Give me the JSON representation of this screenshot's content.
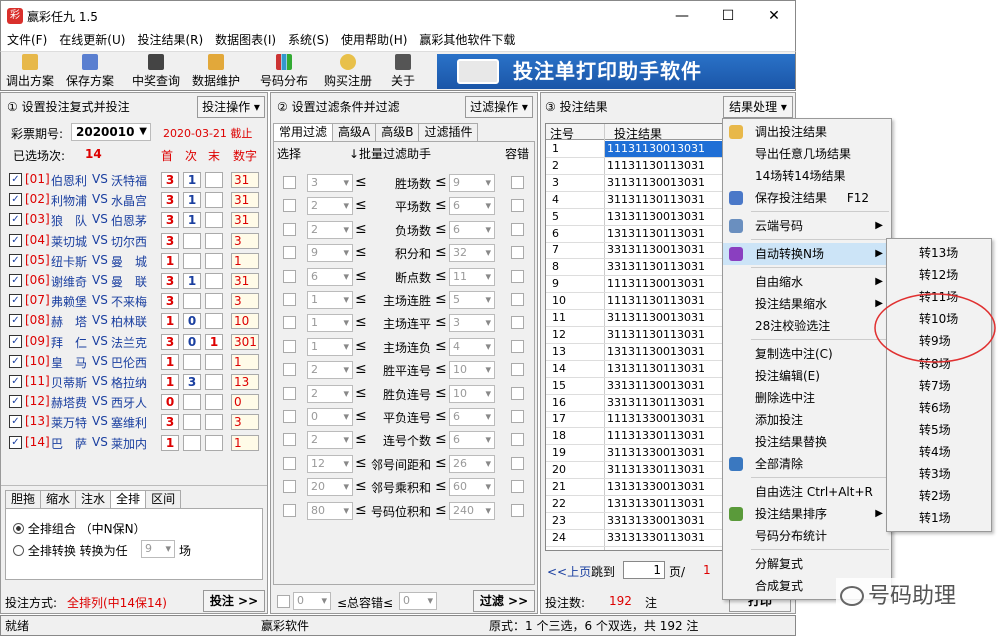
{
  "window": {
    "title": "赢彩任九 1.5",
    "min": "—",
    "max": "☐",
    "close": "✕"
  },
  "menubar": [
    "文件(F)",
    "在线更新(U)",
    "投注结果(R)",
    "数据图表(I)",
    "系统(S)",
    "使用帮助(H)",
    "赢彩其他软件下载"
  ],
  "toolbar": {
    "items": [
      "调出方案",
      "保存方案",
      "中奖查询",
      "数据维护",
      "号码分布",
      "购买注册",
      "关于"
    ],
    "banner": "投注单打印助手软件"
  },
  "left": {
    "header": "① 设置投注复式并投注",
    "op_button": "投注操作 ▾",
    "issue_label": "彩票期号:",
    "issue": "2020010",
    "issue_date": "2020-03-21 截止",
    "selected_label": "已选场次:",
    "selected_count": "14",
    "cols": [
      "首",
      "次",
      "末",
      "数字"
    ],
    "matches": [
      {
        "no": "[01]",
        "home": "伯恩利",
        "away": "沃特福",
        "a": "3",
        "b": "1",
        "c": "",
        "d": "31"
      },
      {
        "no": "[02]",
        "home": "利物浦",
        "away": "水晶宫",
        "a": "3",
        "b": "1",
        "c": "",
        "d": "31"
      },
      {
        "no": "[03]",
        "home": "狼　队",
        "away": "伯恩茅",
        "a": "3",
        "b": "1",
        "c": "",
        "d": "31"
      },
      {
        "no": "[04]",
        "home": "莱切城",
        "away": "切尔西",
        "a": "3",
        "b": "",
        "c": "",
        "d": "3"
      },
      {
        "no": "[05]",
        "home": "纽卡斯",
        "away": "曼　城",
        "a": "1",
        "b": "",
        "c": "",
        "d": "1"
      },
      {
        "no": "[06]",
        "home": "谢维奇",
        "away": "曼　联",
        "a": "3",
        "b": "1",
        "c": "",
        "d": "31"
      },
      {
        "no": "[07]",
        "home": "弗赖堡",
        "away": "不来梅",
        "a": "3",
        "b": "",
        "c": "",
        "d": "3"
      },
      {
        "no": "[08]",
        "home": "赫　塔",
        "away": "柏林联",
        "a": "1",
        "b": "0",
        "c": "",
        "d": "10"
      },
      {
        "no": "[09]",
        "home": "拜　仁",
        "away": "法兰克",
        "a": "3",
        "b": "0",
        "c": "1",
        "d": "301"
      },
      {
        "no": "[10]",
        "home": "皇　马",
        "away": "巴伦西",
        "a": "1",
        "b": "",
        "c": "",
        "d": "1"
      },
      {
        "no": "[11]",
        "home": "贝蒂斯",
        "away": "格拉纳",
        "a": "1",
        "b": "3",
        "c": "",
        "d": "13"
      },
      {
        "no": "[12]",
        "home": "赫塔费",
        "away": "西牙人",
        "a": "0",
        "b": "",
        "c": "",
        "d": "0"
      },
      {
        "no": "[13]",
        "home": "莱万特",
        "away": "塞维利",
        "a": "3",
        "b": "",
        "c": "",
        "d": "3"
      },
      {
        "no": "[14]",
        "home": "巴　萨",
        "away": "莱加内",
        "a": "1",
        "b": "",
        "c": "",
        "d": "1"
      }
    ],
    "vs": "VS",
    "bottom_tabs": [
      "胆拖",
      "缩水",
      "注水",
      "全排",
      "区间"
    ],
    "radio1": "全排组合 （中N保N）",
    "radio2": "全排转换 转换为任",
    "radio2_val": "9",
    "radio2_unit": "场",
    "mode_label": "投注方式:",
    "mode": "全排列(中14保14)",
    "bet_button": "投注 >>"
  },
  "mid": {
    "header": "② 设置过滤条件并过滤",
    "op_button": "过滤操作 ▾",
    "tabs": [
      "常用过滤",
      "高级A",
      "高级B",
      "过滤插件"
    ],
    "col_select": "选择",
    "col_batch": "↓批量过滤助手",
    "col_tol": "容错",
    "rows": [
      {
        "l": "3",
        "name": "胜场数",
        "r": "9"
      },
      {
        "l": "2",
        "name": "平场数",
        "r": "6"
      },
      {
        "l": "2",
        "name": "负场数",
        "r": "6"
      },
      {
        "l": "9",
        "name": "积分和",
        "r": "32"
      },
      {
        "l": "6",
        "name": "断点数",
        "r": "11"
      },
      {
        "l": "1",
        "name": "主场连胜",
        "r": "5"
      },
      {
        "l": "1",
        "name": "主场连平",
        "r": "3"
      },
      {
        "l": "1",
        "name": "主场连负",
        "r": "4"
      },
      {
        "l": "2",
        "name": "胜平连号",
        "r": "10"
      },
      {
        "l": "2",
        "name": "胜负连号",
        "r": "10"
      },
      {
        "l": "0",
        "name": "平负连号",
        "r": "6"
      },
      {
        "l": "2",
        "name": "连号个数",
        "r": "6"
      },
      {
        "l": "12",
        "name": "邻号间距和",
        "r": "26"
      },
      {
        "l": "20",
        "name": "邻号乘积和",
        "r": "60"
      },
      {
        "l": "80",
        "name": "号码位积和",
        "r": "240"
      }
    ],
    "lt": "≤",
    "total_l": "0",
    "total_label": "≤总容错≤",
    "total_r": "0",
    "filter_button": "过滤 >>"
  },
  "right": {
    "header": "③ 投注结果",
    "op_button": "结果处理 ▾",
    "col_no": "注号",
    "col_res": "投注结果",
    "rows": [
      "11131130013031",
      "11131130113031",
      "31131130013031",
      "31131130113031",
      "13131130013031",
      "13131130113031",
      "33131130013031",
      "33131130113031",
      "11131130013031",
      "11131130113031",
      "31131130013031",
      "31131130113031",
      "13131130013031",
      "13131130113031",
      "33131130013031",
      "33131130113031",
      "11131330013031",
      "11131330113031",
      "31131330013031",
      "31131330113031",
      "13131330013031",
      "13131330113031",
      "33131330013031",
      "33131330113031"
    ],
    "prev": "<<上页",
    "jump": "跳到",
    "page": "1",
    "page_unit": "页/",
    "total_pages": "1",
    "count_label": "投注数:",
    "count": "192",
    "count_unit": "注",
    "print": "打印"
  },
  "context_menu": [
    {
      "label": "调出投注结果",
      "icon": "folder-icon"
    },
    {
      "label": "导出任意几场结果"
    },
    {
      "label": "14场转14场结果"
    },
    {
      "label": "保存投注结果",
      "shortcut": "F12",
      "icon": "save-icon"
    },
    {
      "sep": true
    },
    {
      "label": "云端号码",
      "arrow": true,
      "icon": "cloud-icon"
    },
    {
      "sep": true
    },
    {
      "label": "自动转换N场",
      "arrow": true,
      "icon": "pill-icon",
      "hl": true
    },
    {
      "sep": true
    },
    {
      "label": "自由缩水",
      "arrow": true
    },
    {
      "label": "投注结果缩水",
      "arrow": true
    },
    {
      "label": "28注校验选注"
    },
    {
      "sep": true
    },
    {
      "label": "复制选中注(C)"
    },
    {
      "label": "投注编辑(E)"
    },
    {
      "label": "删除选中注"
    },
    {
      "label": "添加投注"
    },
    {
      "label": "投注结果替换"
    },
    {
      "label": "全部清除",
      "icon": "trash-icon"
    },
    {
      "sep": true
    },
    {
      "label": "自由选注 Ctrl+Alt+R"
    },
    {
      "label": "投注结果排序",
      "arrow": true,
      "icon": "chart-icon"
    },
    {
      "label": "号码分布统计"
    },
    {
      "sep": true
    },
    {
      "label": "分解复式"
    },
    {
      "label": "合成复式"
    }
  ],
  "submenu": [
    "转13场",
    "转12场",
    "转11场",
    "转10场",
    "转9场",
    "转8场",
    "转7场",
    "转6场",
    "转5场",
    "转4场",
    "转3场",
    "转2场",
    "转1场"
  ],
  "watermark": "号码助理",
  "status": {
    "ready": "就绪",
    "vendor": "赢彩软件",
    "info": "原式：1 个三选，6 个双选，共 192 注"
  }
}
